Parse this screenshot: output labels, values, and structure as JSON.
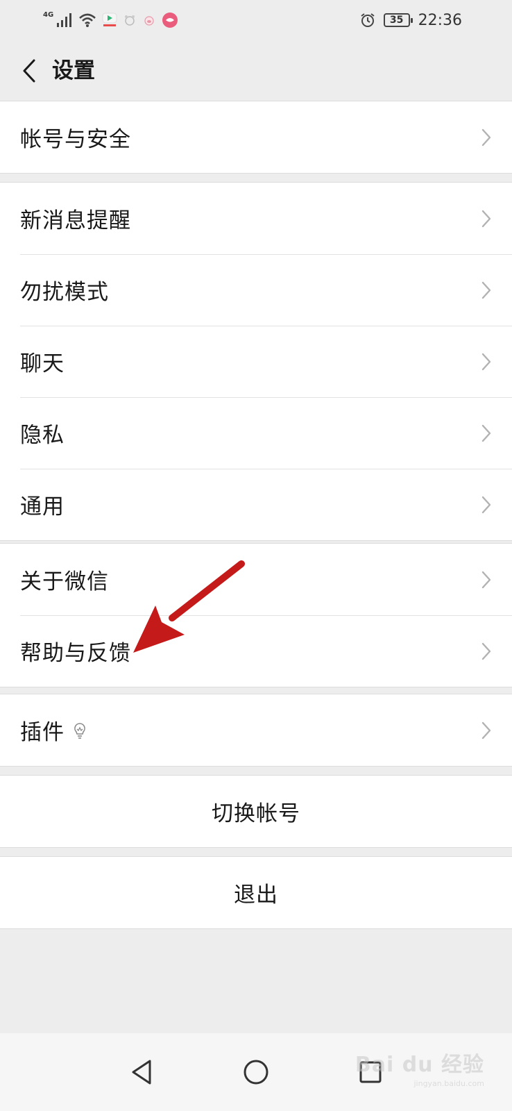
{
  "status_bar": {
    "network_type": "4G",
    "battery_level": "35",
    "time": "22:36",
    "icons": [
      "signal-icon",
      "wifi-icon",
      "video-app-icon",
      "bear-app-icon",
      "pig-app-icon",
      "pink-app-icon",
      "alarm-icon",
      "battery-icon"
    ]
  },
  "nav": {
    "title": "设置"
  },
  "groups": [
    {
      "items": [
        {
          "label": "帐号与安全"
        }
      ]
    },
    {
      "items": [
        {
          "label": "新消息提醒"
        },
        {
          "label": "勿扰模式"
        },
        {
          "label": "聊天"
        },
        {
          "label": "隐私"
        },
        {
          "label": "通用"
        }
      ]
    },
    {
      "items": [
        {
          "label": "关于微信"
        },
        {
          "label": "帮助与反馈"
        }
      ]
    },
    {
      "items": [
        {
          "label": "插件"
        }
      ]
    }
  ],
  "actions": {
    "switch_account": "切换帐号",
    "logout": "退出"
  },
  "watermark": {
    "text": "Bai du 经验",
    "url": "jingyan.baidu.com"
  },
  "colors": {
    "background": "#ededed",
    "cell": "#ffffff",
    "text": "#191919",
    "chevron": "#b2b2b2",
    "annotation_arrow": "#c41a1a"
  }
}
